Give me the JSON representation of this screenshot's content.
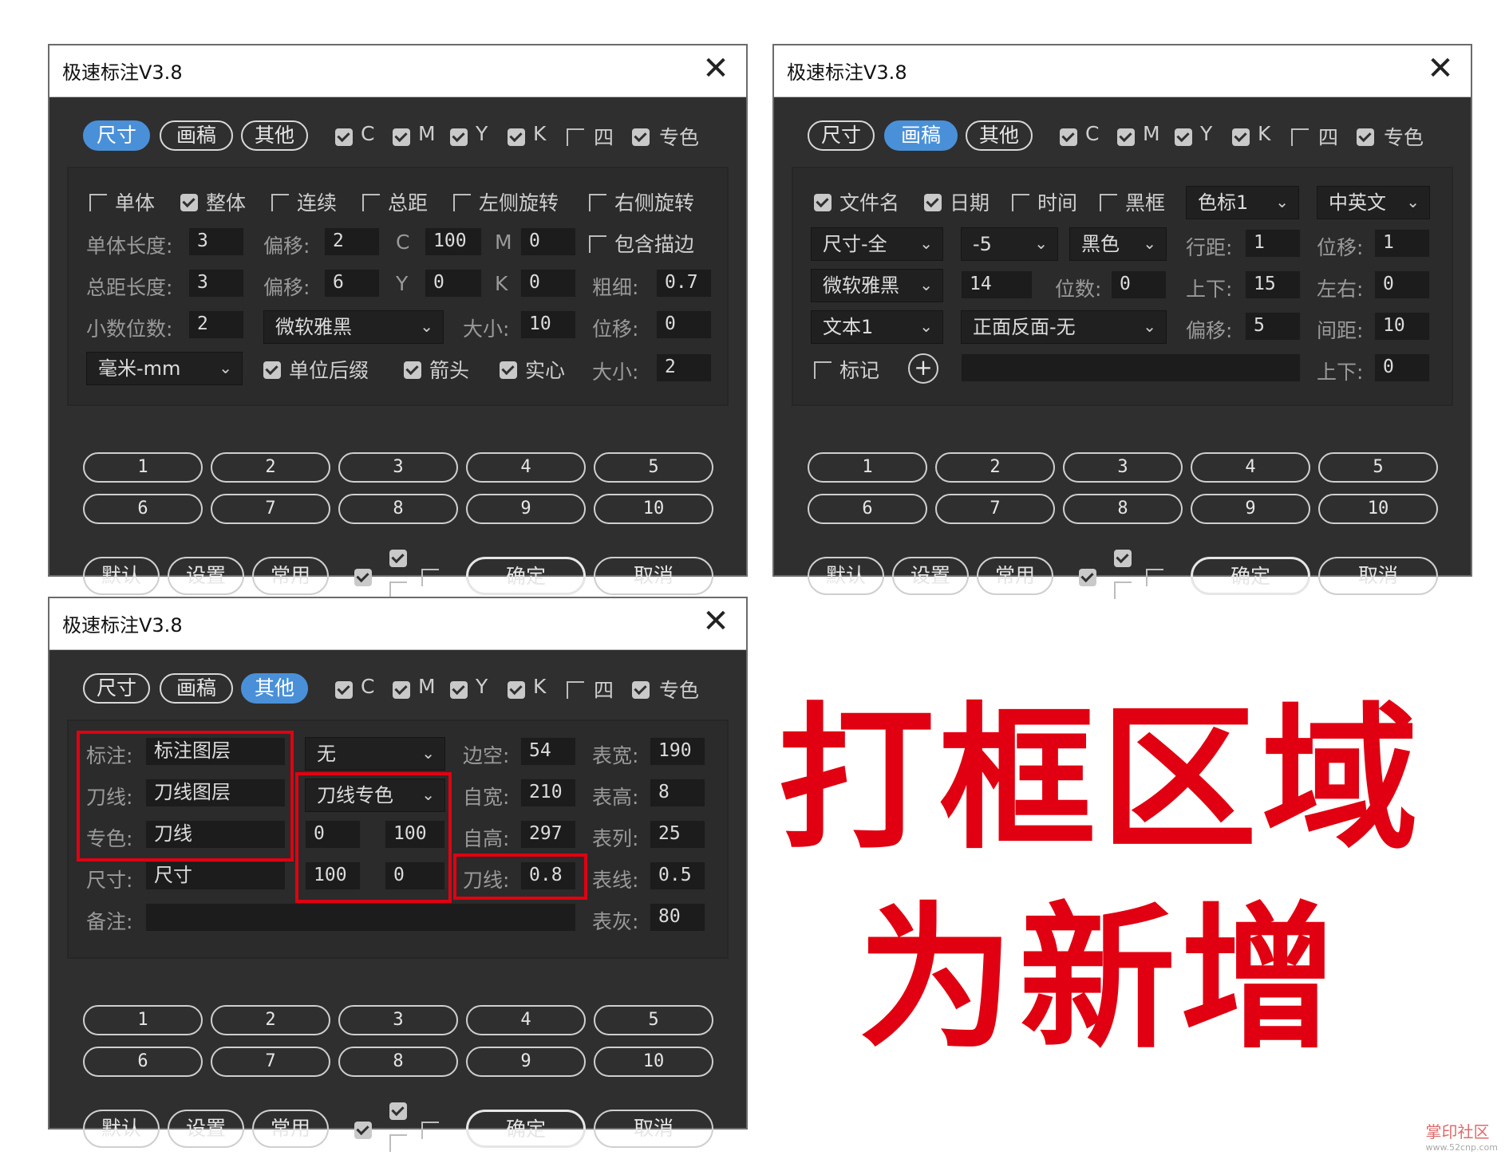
{
  "window_title": "极速标注V3.8",
  "close_glyph": "✕",
  "tabs": [
    "尺寸",
    "画稿",
    "其他"
  ],
  "color_checks": [
    {
      "label": "C",
      "checked": true
    },
    {
      "label": "M",
      "checked": true
    },
    {
      "label": "Y",
      "checked": true
    },
    {
      "label": "K",
      "checked": true
    },
    {
      "label": "四",
      "checked": false
    },
    {
      "label": "专色",
      "checked": true
    }
  ],
  "numbers": [
    "1",
    "2",
    "3",
    "4",
    "5",
    "6",
    "7",
    "8",
    "9",
    "10"
  ],
  "actions": {
    "default": "默认",
    "settings": "设置",
    "common": "常用",
    "ok": "确定",
    "cancel": "取消"
  },
  "panel1": {
    "options": [
      {
        "label": "单体",
        "checked": false
      },
      {
        "label": "整体",
        "checked": true
      },
      {
        "label": "连续",
        "checked": false
      },
      {
        "label": "总距",
        "checked": false
      },
      {
        "label": "左侧旋转",
        "checked": false
      },
      {
        "label": "右侧旋转",
        "checked": false
      }
    ],
    "unit_length_label": "单体长度:",
    "unit_length": "3",
    "offset_label": "偏移:",
    "offset1": "2",
    "c_label": "C",
    "c_value": "100",
    "m_label": "M",
    "m_value": "0",
    "include_stroke": "包含描边",
    "total_length_label": "总距长度:",
    "total_length": "3",
    "offset2": "6",
    "y_label": "Y",
    "y_value": "0",
    "k_label": "K",
    "k_value": "0",
    "thickness_label": "粗细:",
    "thickness": "0.7",
    "decimals_label": "小数位数:",
    "decimals": "2",
    "font": "微软雅黑",
    "size_label": "大小:",
    "size": "10",
    "shift_label": "位移:",
    "shift": "0",
    "unit": "毫米-mm",
    "suffix": "单位后缀",
    "arrow": "箭头",
    "solid": "实心",
    "size2_label": "大小:",
    "size2": "2"
  },
  "panel2": {
    "filename": "文件名",
    "date": "日期",
    "time": "时间",
    "black_frame": "黑框",
    "color_mark": "色标1",
    "language": "中英文",
    "size_mode": "尺寸-全",
    "offset_sel": "-5",
    "color_sel": "黑色",
    "line_spacing_label": "行距:",
    "line_spacing": "1",
    "shift_label": "位移:",
    "shift": "1",
    "font": "微软雅黑",
    "font_size": "14",
    "digits_label": "位数:",
    "digits": "0",
    "updown_label": "上下:",
    "updown": "15",
    "leftright_label": "左右:",
    "leftright": "0",
    "text_sel": "文本1",
    "side_sel": "正面反面-无",
    "offset_label": "偏移:",
    "offset": "5",
    "gap_label": "间距:",
    "gap": "10",
    "mark_label": "标记",
    "plus": "+",
    "updown2_label": "上下:",
    "updown2": "0"
  },
  "panel3": {
    "annot_label": "标注:",
    "annot_layer": "标注图层",
    "knife_label": "刀线:",
    "knife_layer": "刀线图层",
    "spot_label": "专色:",
    "spot_value": "刀线",
    "size_label": "尺寸:",
    "size_value": "尺寸",
    "note_label": "备注:",
    "note_value": "",
    "none_sel": "无",
    "knife_spot_sel": "刀线专色",
    "v1": "0",
    "v2": "100",
    "v3": "100",
    "v4": "0",
    "margin_label": "边空:",
    "margin": "54",
    "self_width_label": "自宽:",
    "self_width": "210",
    "self_height_label": "自高:",
    "self_height": "297",
    "knife_line_label": "刀线:",
    "knife_line": "0.8",
    "table_width_label": "表宽:",
    "table_width": "190",
    "table_height_label": "表高:",
    "table_height": "8",
    "table_cols_label": "表列:",
    "table_cols": "25",
    "table_line_label": "表线:",
    "table_line": "0.5",
    "table_gray_label": "表灰:",
    "table_gray": "80"
  },
  "caption": {
    "line1": "打框区域",
    "line2": "为新增"
  },
  "watermark": {
    "main": "掌印社区",
    "sub": "www.52cnp.com"
  },
  "colors": {
    "accent": "#4a90d9",
    "highlight": "#e10011",
    "panel": "#2f2f2f"
  }
}
